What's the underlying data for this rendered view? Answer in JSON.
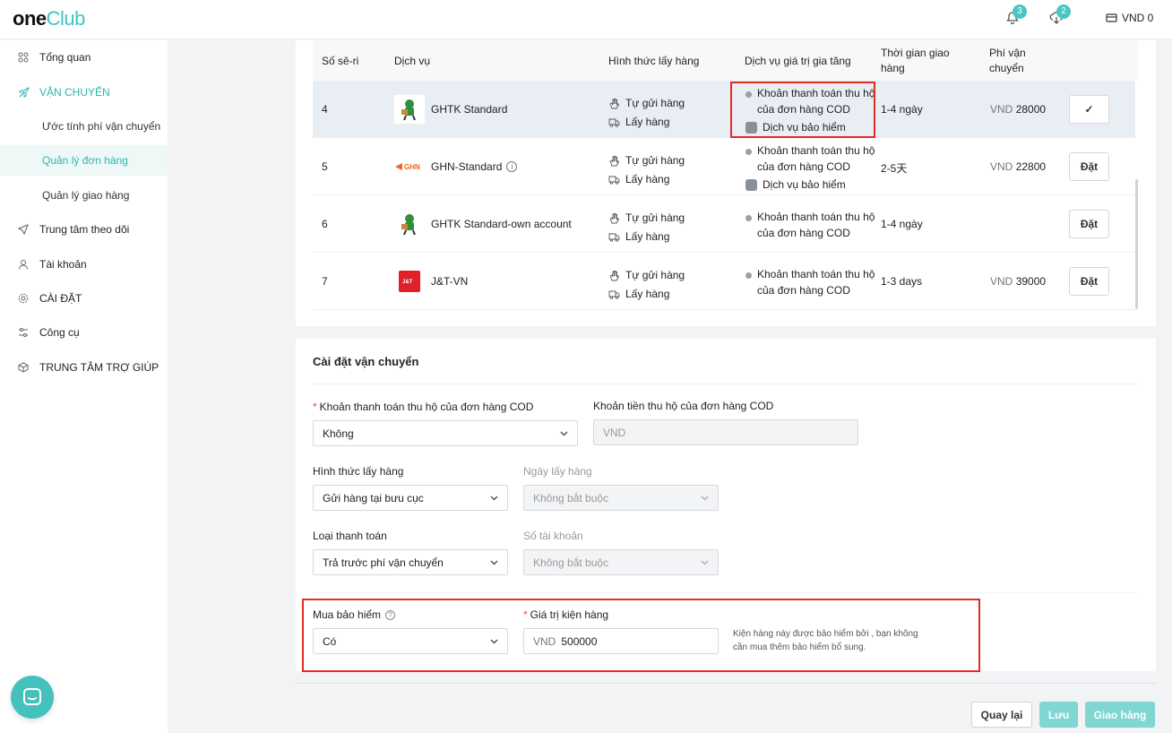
{
  "header": {
    "logo_one": "one",
    "logo_club": "Club",
    "notifications_count": "3",
    "downloads_count": "2",
    "wallet": "VND 0"
  },
  "sidebar": {
    "items": [
      {
        "label": "Tổng quan",
        "icon": "grid-icon"
      },
      {
        "label": "VẬN CHUYỂN",
        "icon": "rocket-icon"
      },
      {
        "label": "Trung tâm theo dõi",
        "icon": "send-icon"
      },
      {
        "label": "Tài khoản",
        "icon": "user-icon"
      },
      {
        "label": "CÀI ĐẶT",
        "icon": "settings-icon"
      },
      {
        "label": "Công cụ",
        "icon": "tools-icon"
      },
      {
        "label": "TRUNG TÂM TRỢ GIÚP",
        "icon": "box-icon"
      }
    ],
    "sub_items": [
      {
        "label": "Ước tính phí vận chuyển"
      },
      {
        "label": "Quản lý đơn hàng"
      },
      {
        "label": "Quản lý giao hàng"
      }
    ]
  },
  "table": {
    "headers": {
      "serial": "Số sê-ri",
      "service": "Dịch vụ",
      "pickup": "Hình thức lấy hàng",
      "vas": "Dịch vụ giá trị gia tăng",
      "time": "Thời gian giao hàng",
      "fee": "Phí vận chuyển"
    },
    "rows": [
      {
        "num": "4",
        "service": "GHTK Standard",
        "pick1": "Tự gửi hàng",
        "pick2": "Lấy hàng",
        "vas1": "Khoản thanh toán thu hộ của đơn hàng COD",
        "vas2": "Dịch vụ bảo hiểm",
        "time": "1-4 ngày",
        "currency": "VND",
        "fee": "28000",
        "action": "✓"
      },
      {
        "num": "5",
        "service": "GHN-Standard",
        "pick1": "Tự gửi hàng",
        "pick2": "Lấy hàng",
        "vas1": "Khoản thanh toán thu hộ của đơn hàng COD",
        "vas2": "Dịch vụ bảo hiểm",
        "time": "2-5天",
        "currency": "VND",
        "fee": "22800",
        "action": "Đặt"
      },
      {
        "num": "6",
        "service": "GHTK Standard-own account",
        "pick1": "Tự gửi hàng",
        "pick2": "Lấy hàng",
        "vas1": "Khoản thanh toán thu hộ của đơn hàng COD",
        "time": "1-4 ngày",
        "action": "Đặt"
      },
      {
        "num": "7",
        "service": "J&T-VN",
        "pick1": "Tự gửi hàng",
        "pick2": "Lấy hàng",
        "vas1": "Khoản thanh toán thu hộ của đơn hàng COD",
        "time": "1-3 days",
        "currency": "VND",
        "fee": "39000",
        "action": "Đặt"
      }
    ]
  },
  "settings": {
    "title": "Cài đặt vận chuyển",
    "cod_label": "Khoản thanh toán thu hộ của đơn hàng COD",
    "cod_value": "Không",
    "cod_amount_label": "Khoản tiền thu hộ của đơn hàng COD",
    "cod_amount_placeholder": "VND",
    "pickup_label": "Hình thức lấy hàng",
    "pickup_value": "Gửi hàng tại bưu cục",
    "pickup_date_label": "Ngày lấy hàng",
    "pickup_date_value": "Không bắt buộc",
    "payment_label": "Loại thanh toán",
    "payment_value": "Trả trước phí vận chuyển",
    "account_label": "Số tài khoản",
    "account_value": "Không bắt buộc",
    "insurance_label": "Mua bảo hiểm",
    "insurance_value": "Có",
    "package_value_label": "Giá trị kiện hàng",
    "package_currency": "VND",
    "package_value": "500000",
    "insurance_hint": "Kiện hàng này được bảo hiểm bởi , bạn không cần mua thêm bảo hiểm bổ sung."
  },
  "footer": {
    "back": "Quay lại",
    "save": "Lưu",
    "ship": "Giao hàng"
  }
}
